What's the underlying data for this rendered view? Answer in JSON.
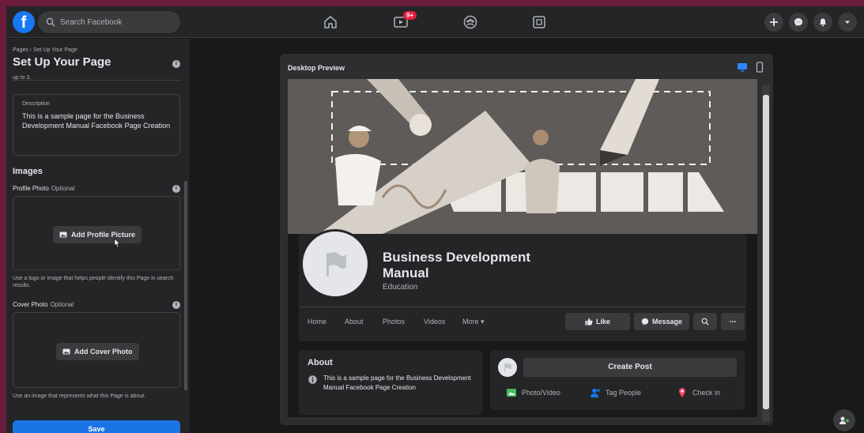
{
  "topnav": {
    "logo": "f",
    "search_placeholder": "Search Facebook",
    "notifications_badge": "9+",
    "icons": [
      "home-icon",
      "watch-icon",
      "groups-icon",
      "gaming-icon",
      "plus-icon",
      "messenger-icon",
      "bell-icon",
      "caret-down-icon"
    ]
  },
  "setup": {
    "breadcrumb": "Pages › Set Up Your Page",
    "title": "Set Up Your Page",
    "upto_text": "up to 3.",
    "description": {
      "label": "Description",
      "value": "This is a sample page for the Business Development Manual Facebook Page Creation"
    },
    "images_heading": "Images",
    "profile_photo": {
      "label": "Profile Photo",
      "optional": "Optional",
      "button": "Add Profile Picture",
      "hint": "Use a logo or image that helps people identify this Page in search results."
    },
    "cover_photo": {
      "label": "Cover Photo",
      "optional": "Optional",
      "button": "Add Cover Photo",
      "hint": "Use an image that represents what this Page is about."
    },
    "save": "Save"
  },
  "preview": {
    "title": "Desktop Preview",
    "page_name": "Business Development Manual",
    "category": "Education",
    "tabs": [
      "Home",
      "About",
      "Photos",
      "Videos",
      "More ▾"
    ],
    "actions": {
      "like": "Like",
      "message": "Message"
    },
    "about": {
      "heading": "About",
      "text": "This is a sample page for the Business Development Manual Facebook Page Creation"
    },
    "post": {
      "create": "Create Post",
      "photo_video": "Photo/Video",
      "tag_people": "Tag People",
      "check_in": "Check in"
    }
  },
  "colors": {
    "accent": "#1b74e4",
    "frame": "#6b1c3b",
    "background": "#18191a",
    "surface": "#242526"
  }
}
